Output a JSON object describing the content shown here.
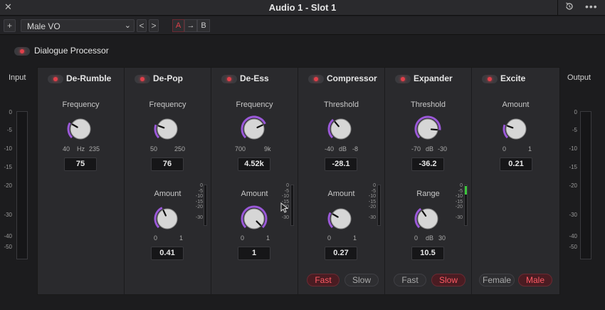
{
  "window": {
    "title": "Audio 1 - Slot 1"
  },
  "toolbar": {
    "preset": "Male VO",
    "a_label": "A",
    "copy_label": "→",
    "b_label": "B",
    "prev": "<",
    "next": ">",
    "add": "+"
  },
  "processor": {
    "label": "Dialogue Processor"
  },
  "meters": {
    "input_label": "Input",
    "output_label": "Output",
    "scale": [
      "0",
      "-5",
      "-10",
      "-15",
      "-20",
      "-30",
      "-40",
      "-50"
    ],
    "mini_scale": [
      "0",
      "-5",
      "-10",
      "-15",
      "-20",
      "-30"
    ]
  },
  "modules": {
    "derumble": {
      "title": "De-Rumble",
      "freq_label": "Frequency",
      "freq_min": "40",
      "freq_unit": "Hz",
      "freq_max": "235",
      "freq_value": "75"
    },
    "depop": {
      "title": "De-Pop",
      "freq_label": "Frequency",
      "freq_min": "50",
      "freq_max": "250",
      "freq_value": "76",
      "amount_label": "Amount",
      "amount_min": "0",
      "amount_max": "1",
      "amount_value": "0.41"
    },
    "deess": {
      "title": "De-Ess",
      "freq_label": "Frequency",
      "freq_min": "700",
      "freq_max": "9k",
      "freq_value": "4.52k",
      "amount_label": "Amount",
      "amount_min": "0",
      "amount_max": "1",
      "amount_value": "1"
    },
    "compressor": {
      "title": "Compressor",
      "thr_label": "Threshold",
      "thr_min": "-40",
      "thr_unit": "dB",
      "thr_max": "-8",
      "thr_value": "-28.1",
      "amount_label": "Amount",
      "amount_min": "0",
      "amount_max": "1",
      "amount_value": "0.27",
      "fast": "Fast",
      "slow": "Slow"
    },
    "expander": {
      "title": "Expander",
      "thr_label": "Threshold",
      "thr_min": "-70",
      "thr_unit": "dB",
      "thr_max": "-30",
      "thr_value": "-36.2",
      "range_label": "Range",
      "range_min": "0",
      "range_unit": "dB",
      "range_max": "30",
      "range_value": "10.5",
      "fast": "Fast",
      "slow": "Slow"
    },
    "excite": {
      "title": "Excite",
      "amount_label": "Amount",
      "amount_min": "0",
      "amount_max": "1",
      "amount_value": "0.21",
      "female": "Female",
      "male": "Male"
    }
  },
  "colors": {
    "accent": "#9b59d9",
    "active_red": "#e0404a",
    "meter_green": "#3cc83c"
  }
}
